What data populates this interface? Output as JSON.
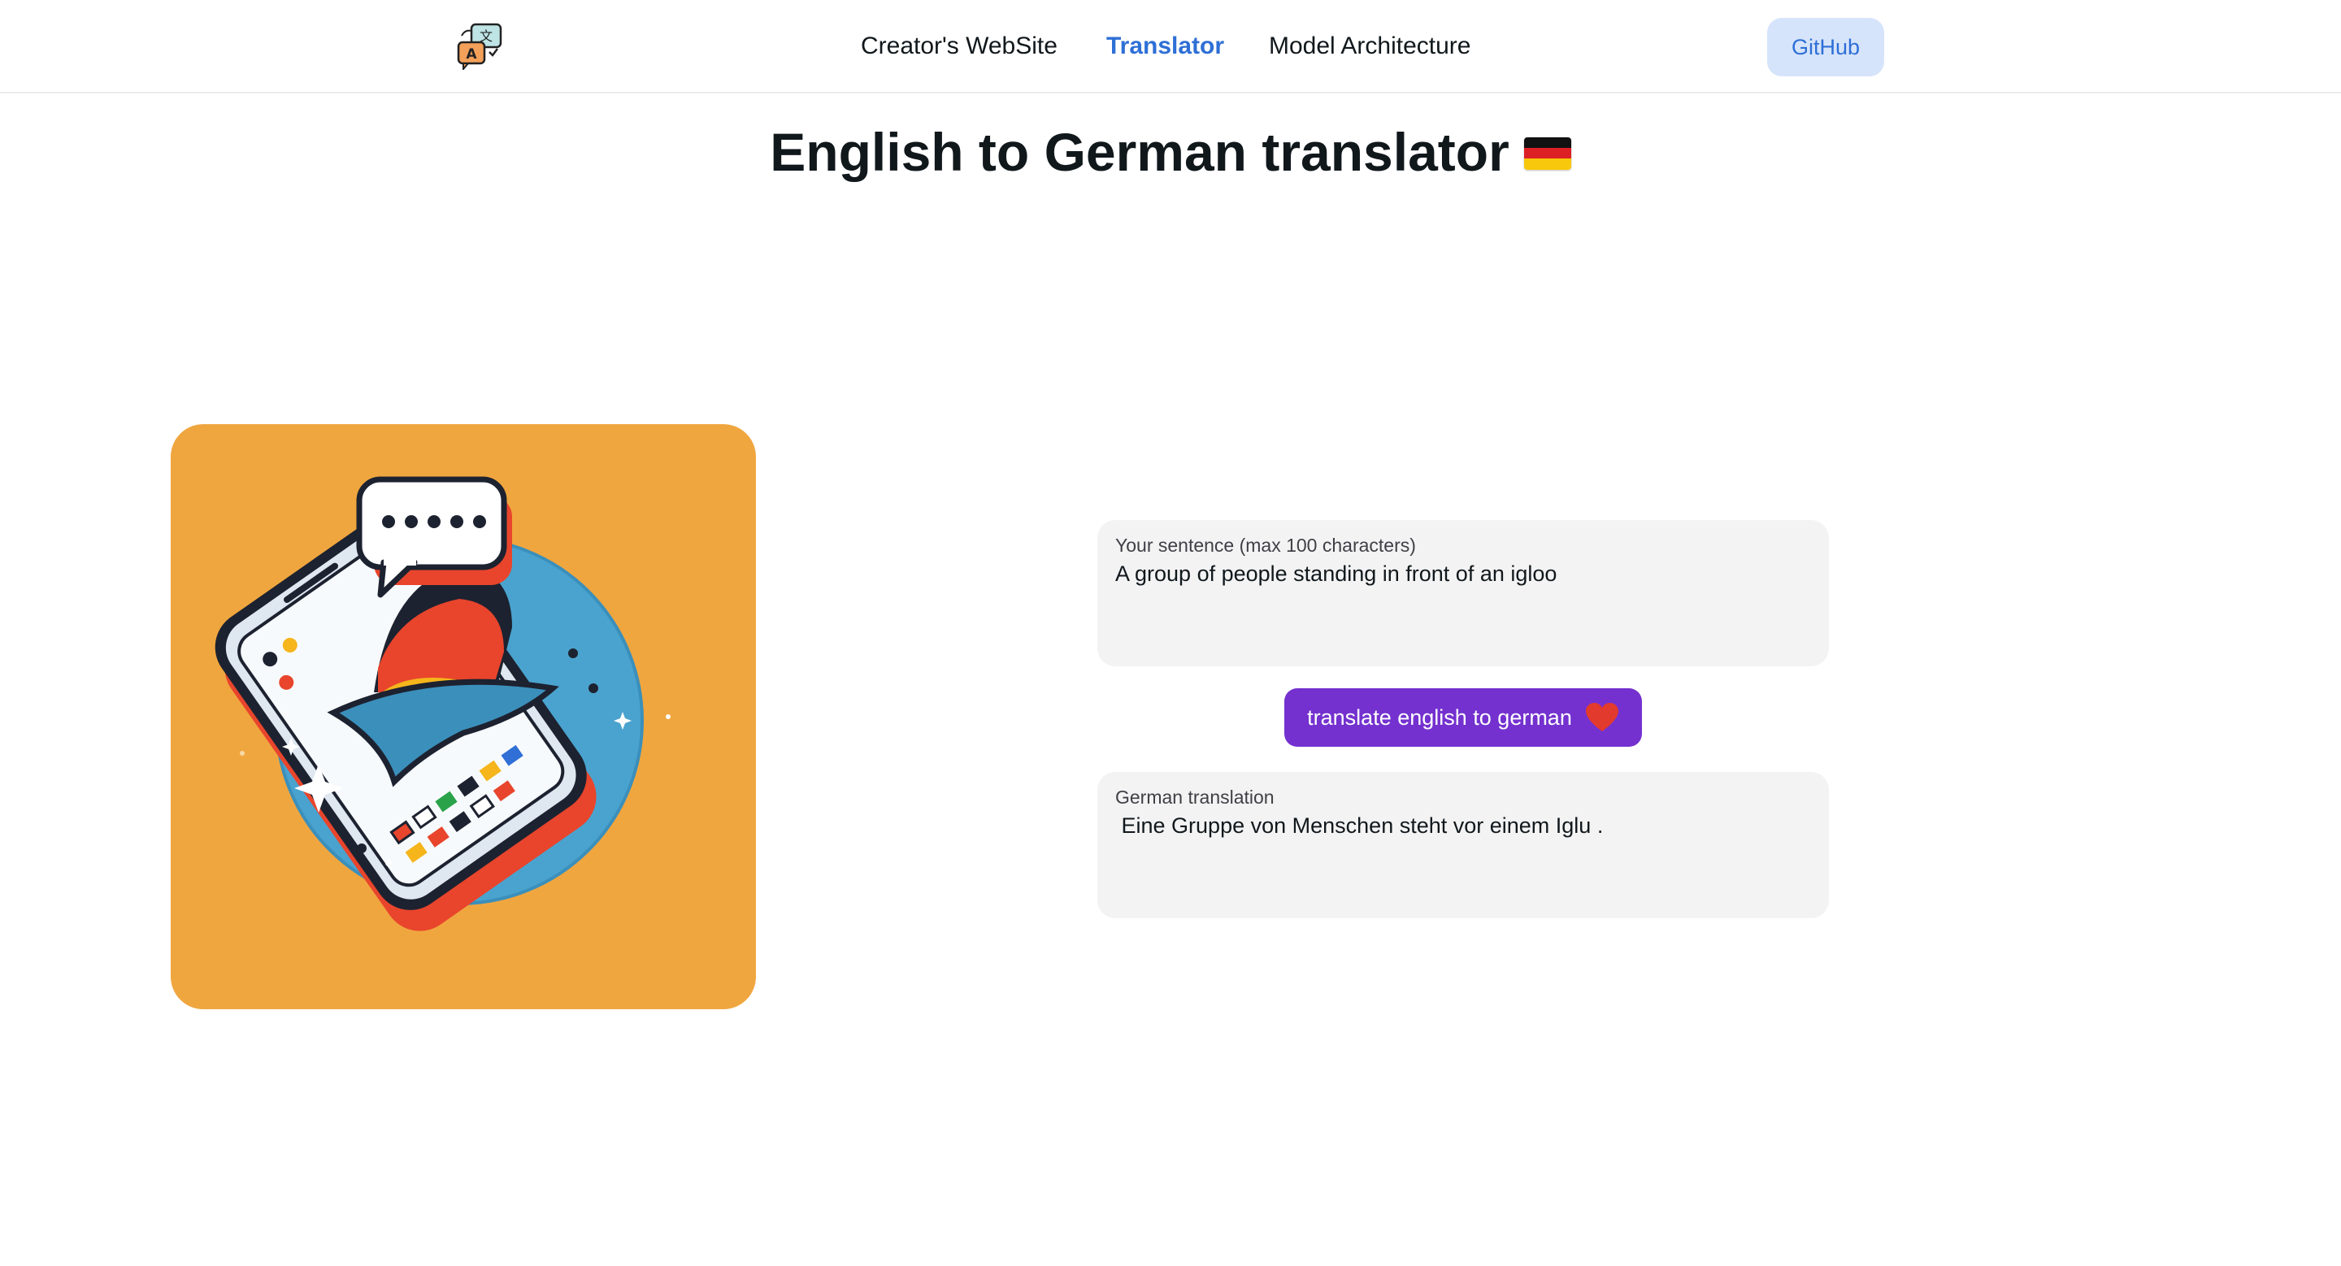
{
  "navbar": {
    "logo_name": "translate-logo-icon",
    "links": [
      {
        "label": "Creator's WebSite",
        "active": false
      },
      {
        "label": "Translator",
        "active": true
      },
      {
        "label": "Model Architecture",
        "active": false
      }
    ],
    "github_label": "GitHub"
  },
  "page": {
    "title": "English to German translator",
    "flag_icon": "german-flag-icon"
  },
  "input": {
    "label": "Your sentence (max 100 characters)",
    "value": "A group of people standing in front of an igloo"
  },
  "button": {
    "label": "translate english to german",
    "icon": "heart-icon"
  },
  "output": {
    "label": "German translation",
    "value": " Eine Gruppe von Menschen steht vor einem Iglu ."
  },
  "colors": {
    "accent_blue": "#2e6fd6",
    "github_bg": "#d6e4fb",
    "button_purple": "#7431cf",
    "illustration_bg": "#f0a63f",
    "field_bg": "#f3f3f3"
  }
}
